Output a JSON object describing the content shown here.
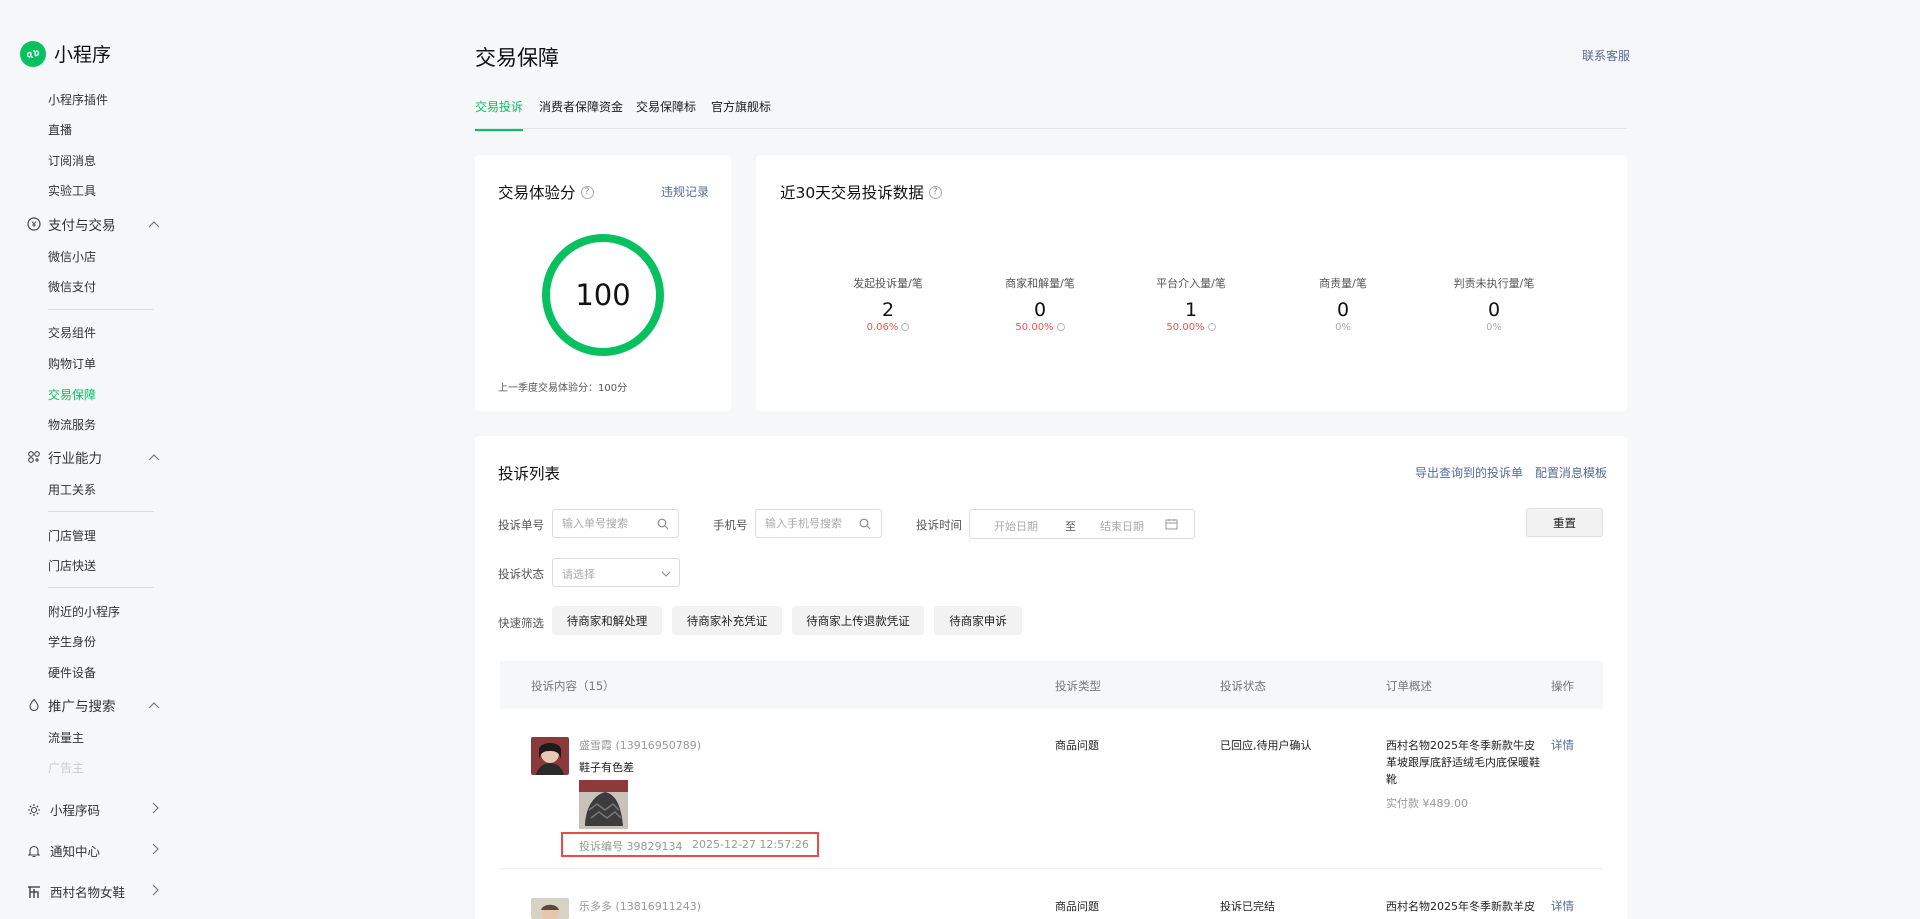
{
  "sidebar": {
    "logo_text": "小程序",
    "items_top": [
      "小程序插件",
      "直播",
      "订阅消息",
      "实验工具"
    ],
    "group_pay": "支付与交易",
    "pay_items_a": [
      "微信小店",
      "微信支付"
    ],
    "pay_items_b": [
      "交易组件",
      "购物订单",
      "交易保障",
      "物流服务"
    ],
    "group_industry": "行业能力",
    "industry_items_a": [
      "用工关系"
    ],
    "industry_items_b": [
      "门店管理",
      "门店快送"
    ],
    "industry_items_c": [
      "附近的小程序",
      "学生身份",
      "硬件设备"
    ],
    "group_promo": "推广与搜索",
    "promo_items": [
      "流量主",
      "广告主"
    ],
    "bottom_code": "小程序码",
    "bottom_notify": "通知中心",
    "bottom_account": "西村名物女鞋"
  },
  "header": {
    "title": "交易保障",
    "contact": "联系客服"
  },
  "tabs": [
    "交易投诉",
    "消费者保障资金",
    "交易保障标",
    "官方旗舰标"
  ],
  "score_card": {
    "title": "交易体验分",
    "link": "违规记录",
    "score": "100",
    "note": "上一季度交易体验分：100分"
  },
  "stats_card": {
    "title": "近30天交易投诉数据",
    "stats": [
      {
        "label": "发起投诉量/笔",
        "value": "2",
        "pct": "0.06%"
      },
      {
        "label": "商家和解量/笔",
        "value": "0",
        "pct": "50.00%"
      },
      {
        "label": "平台介入量/笔",
        "value": "1",
        "pct": "50.00%"
      },
      {
        "label": "商责量/笔",
        "value": "0",
        "pct": "0%"
      },
      {
        "label": "判责未执行量/笔",
        "value": "0",
        "pct": "0%"
      }
    ]
  },
  "list": {
    "title": "投诉列表",
    "export_link": "导出查询到的投诉单",
    "config_link": "配置消息模板",
    "filter_no_label": "投诉单号",
    "filter_no_placeholder": "输入单号搜索",
    "filter_phone_label": "手机号",
    "filter_phone_placeholder": "输入手机号搜索",
    "filter_time_label": "投诉时间",
    "start_date": "开始日期",
    "to": "至",
    "end_date": "结束日期",
    "reset": "重置",
    "status_label": "投诉状态",
    "status_placeholder": "请选择",
    "quick_label": "快速筛选",
    "quick_filters": [
      "待商家和解处理",
      "待商家补充凭证",
      "待商家上传退款凭证",
      "待商家申诉"
    ],
    "columns": [
      "投诉内容（15）",
      "投诉类型",
      "投诉状态",
      "订单概述",
      "操作"
    ],
    "rows": [
      {
        "user": "盛雪霞 (13916950789)",
        "content": "鞋子有色差",
        "complaint_no": "投诉编号 39829134",
        "time": "2025-12-27 12:57:26",
        "type": "商品问题",
        "status": "已回应,待用户确认",
        "order_line1": "西村名物2025年冬季新款牛皮",
        "order_line2": "革坡跟厚底舒适绒毛内底保暖鞋",
        "order_line3": "靴",
        "paid": "实付款 ¥489.00",
        "action": "详情"
      },
      {
        "user": "乐多多 (13816911243)",
        "type": "商品问题",
        "status": "投诉已完结",
        "order_line1": "西村名物2025年冬季新款羊皮",
        "action": "详情"
      }
    ]
  },
  "colors": {
    "accent": "#07c160",
    "link": "#576b95",
    "danger": "#fa5151",
    "highlight": "#e94b4b"
  }
}
